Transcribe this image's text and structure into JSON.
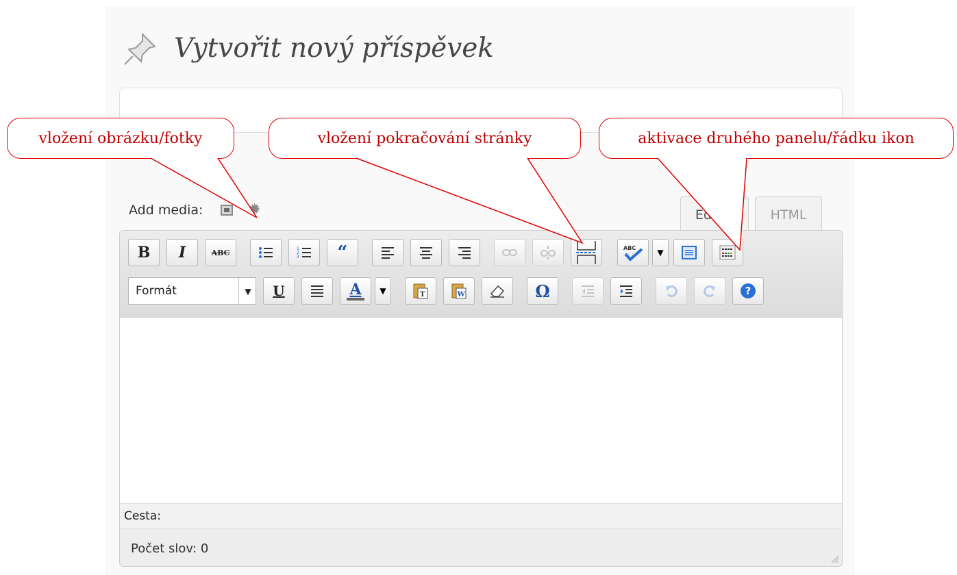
{
  "page_title": "Vytvořit nový příspěvek",
  "add_media": {
    "label": "Add media:"
  },
  "tabs": {
    "editor": "Editor",
    "html": "HTML"
  },
  "toolbar": {
    "bold": "B",
    "italic": "I",
    "strikethrough": "ABC",
    "blockquote": "“",
    "underline": "U",
    "text_color": "A",
    "special_char": "Ω",
    "help": "?",
    "format_value": "Formát"
  },
  "path_bar": {
    "label": "Cesta:"
  },
  "word_count": {
    "label": "Počet slov: 0"
  },
  "callouts": {
    "image": "vložení obrázku/fotky",
    "more": "vložení pokračování stránky",
    "kitchen_sink": "aktivace druhého panelu/řádku ikon"
  },
  "colors": {
    "callout_red": "#e00000",
    "panel_bg": "#f9f9f9",
    "toolbar_bg": "#e4e4e4"
  }
}
